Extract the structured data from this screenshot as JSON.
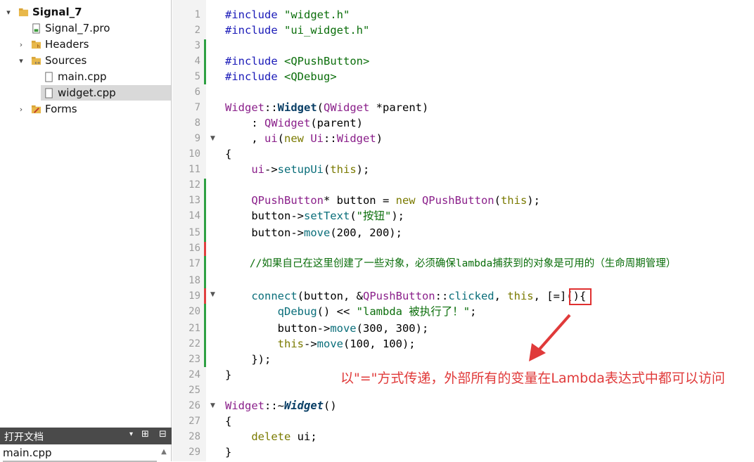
{
  "project_tree": {
    "project_name": "Signal_7",
    "pro_file": "Signal_7.pro",
    "headers": "Headers",
    "sources": "Sources",
    "main_cpp": "main.cpp",
    "widget_cpp": "widget.cpp",
    "forms": "Forms"
  },
  "open_documents": {
    "title": "打开文档",
    "item": "main.cpp"
  },
  "line_numbers": [
    "1",
    "2",
    "3",
    "4",
    "5",
    "6",
    "7",
    "8",
    "9",
    "10",
    "11",
    "12",
    "13",
    "14",
    "15",
    "16",
    "17",
    "18",
    "19",
    "20",
    "21",
    "22",
    "23",
    "24",
    "25",
    "26",
    "27",
    "28",
    "29"
  ],
  "code": {
    "l1a": "#include ",
    "l1b": "\"widget.h\"",
    "l2a": "#include ",
    "l2b": "\"ui_widget.h\"",
    "l4a": "#include ",
    "l4b": "<QPushButton>",
    "l5a": "#include ",
    "l5b": "<QDebug>",
    "l7a": "Widget",
    "l7b": "::",
    "l7c": "Widget",
    "l7d": "(",
    "l7e": "QWidget",
    "l7f": " *parent)",
    "l8a": "    : ",
    "l8b": "QWidget",
    "l8c": "(parent)",
    "l9a": "    , ",
    "l9b": "ui",
    "l9c": "(",
    "l9d": "new ",
    "l9e": "Ui",
    "l9f": "::",
    "l9g": "Widget",
    "l9h": ")",
    "l10": "{",
    "l11a": "    ",
    "l11b": "ui",
    "l11c": "->",
    "l11d": "setupUi",
    "l11e": "(",
    "l11f": "this",
    "l11g": ");",
    "l13a": "    ",
    "l13b": "QPushButton",
    "l13c": "* button = ",
    "l13d": "new ",
    "l13e": "QPushButton",
    "l13f": "(",
    "l13g": "this",
    "l13h": ");",
    "l14a": "    button->",
    "l14b": "setText",
    "l14c": "(",
    "l14d": "\"按钮\"",
    "l14e": ");",
    "l15a": "    button->",
    "l15b": "move",
    "l15c": "(200, 200);",
    "l17": "    //如果自己在这里创建了一些对象，必须确保lambda捕获到的对象是可用的（生命周期管理）",
    "l19a": "    ",
    "l19b": "connect",
    "l19c": "(button, &",
    "l19d": "QPushButton",
    "l19e": "::",
    "l19f": "clicked",
    "l19g": ", ",
    "l19h": "this",
    "l19i": ", [=](){",
    "l20a": "        ",
    "l20b": "qDebug",
    "l20c": "() << ",
    "l20d": "\"lambda 被执行了！\"",
    "l20e": ";",
    "l21a": "        button->",
    "l21b": "move",
    "l21c": "(300, 300);",
    "l22a": "        ",
    "l22b": "this",
    "l22c": "->",
    "l22d": "move",
    "l22e": "(100, 100);",
    "l23": "    });",
    "l24": "}",
    "l26a": "Widget",
    "l26b": "::~",
    "l26c": "Widget",
    "l26d": "()",
    "l27": "{",
    "l28a": "    ",
    "l28b": "delete",
    "l28c": " ui;",
    "l29": "}"
  },
  "annotation": "以\"=\"方式传递，外部所有的变量在Lambda表达式中都可以访问",
  "colors": {
    "annotation_red": "#e03a3a",
    "gutter_change_green": "#2ea043",
    "gutter_change_red": "#e04040"
  }
}
